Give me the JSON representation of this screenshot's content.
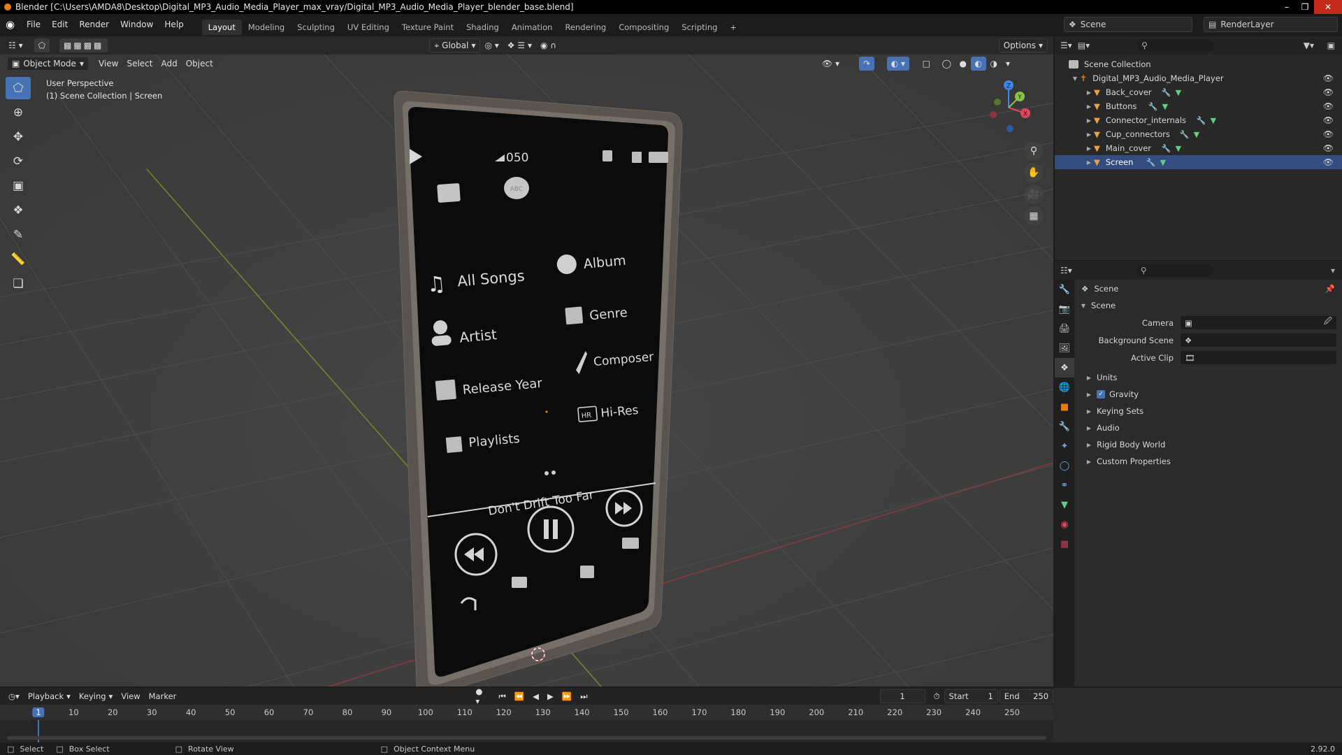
{
  "window": {
    "title": "Blender [C:\\Users\\AMDA8\\Desktop\\Digital_MP3_Audio_Media_Player_max_vray/Digital_MP3_Audio_Media_Player_blender_base.blend]"
  },
  "menu": {
    "items": [
      "File",
      "Edit",
      "Render",
      "Window",
      "Help"
    ],
    "workspaces": [
      "Layout",
      "Modeling",
      "Sculpting",
      "UV Editing",
      "Texture Paint",
      "Shading",
      "Animation",
      "Rendering",
      "Compositing",
      "Scripting"
    ],
    "active_workspace": "Layout",
    "add_tab": "+",
    "scene": "Scene",
    "view_layer": "RenderLayer"
  },
  "viewport": {
    "transform_orientation": "Global",
    "options_label": "Options",
    "mode": "Object Mode",
    "menus": [
      "View",
      "Select",
      "Add",
      "Object"
    ],
    "view_name": "User Perspective",
    "collection_info": "(1) Scene Collection | Screen"
  },
  "phone_screen": {
    "volume": "050",
    "abc": "ABC",
    "menu": [
      "All Songs",
      "Album",
      "Artist",
      "Genre",
      "Release Year",
      "Composer",
      "Playlists",
      "Hi-Res"
    ],
    "hr_badge": "HR",
    "song": "Don't Drift Too Far"
  },
  "gizmo": {
    "z": "Z",
    "y": "Y",
    "x": "X"
  },
  "outliner": {
    "root": "Scene Collection",
    "collection": "Digital_MP3_Audio_Media_Player",
    "objects": [
      "Back_cover",
      "Buttons",
      "Connector_internals",
      "Cup_connectors",
      "Main_cover",
      "Screen"
    ]
  },
  "properties": {
    "header": "Scene",
    "panel": "Scene",
    "camera_label": "Camera",
    "background_label": "Background Scene",
    "clip_label": "Active Clip",
    "subpanels": [
      "Units",
      "Gravity",
      "Keying Sets",
      "Audio",
      "Rigid Body World",
      "Custom Properties"
    ],
    "gravity_checked": true
  },
  "timeline": {
    "menus": [
      "Playback",
      "Keying",
      "View",
      "Marker"
    ],
    "current_frame": "1",
    "start_label": "Start",
    "start": "1",
    "end_label": "End",
    "end": "250",
    "ticks": [
      "1",
      "10",
      "20",
      "30",
      "40",
      "50",
      "60",
      "70",
      "80",
      "90",
      "100",
      "110",
      "120",
      "130",
      "140",
      "150",
      "160",
      "170",
      "180",
      "190",
      "200",
      "210",
      "220",
      "230",
      "240",
      "250"
    ]
  },
  "statusbar": {
    "select": "Select",
    "box_select": "Box Select",
    "rotate": "Rotate View",
    "context": "Object Context Menu",
    "version": "2.92.0"
  },
  "colors": {
    "accent": "#4772b3",
    "orange": "#e87d0d",
    "x_axis": "#e2475b",
    "y_axis": "#8ac34a",
    "z_axis": "#3e86e8"
  }
}
